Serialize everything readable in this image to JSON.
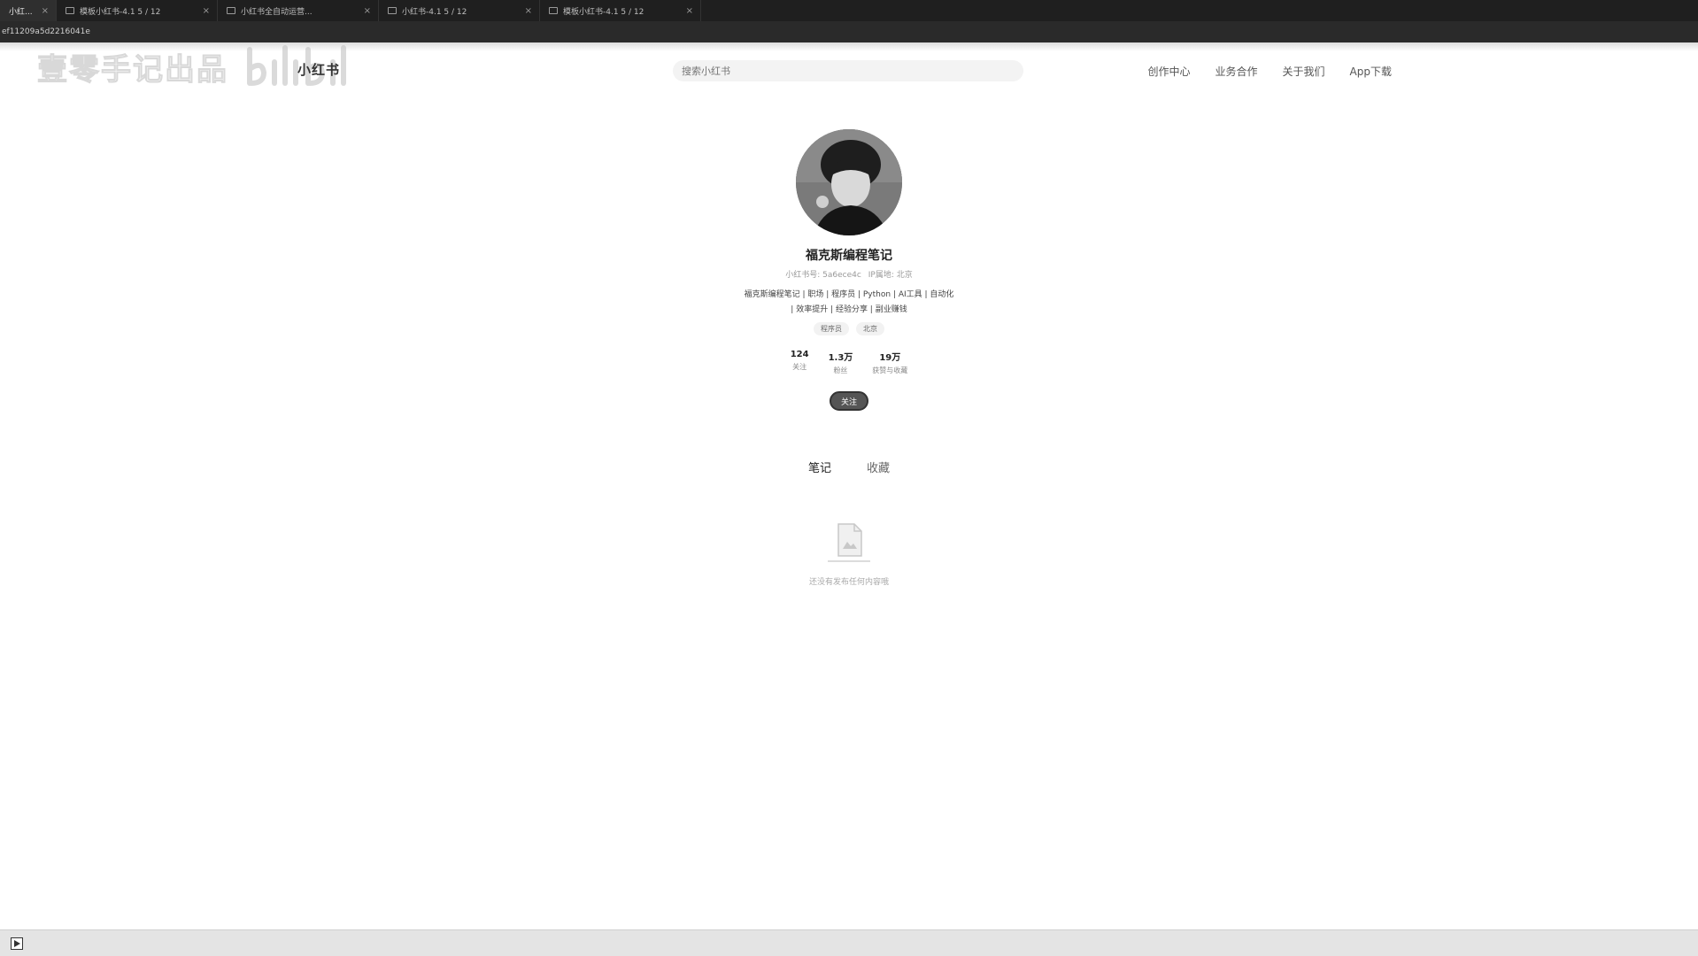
{
  "browser": {
    "tabs": [
      {
        "title": "小红...",
        "active": true
      },
      {
        "title": "模板小红书-4.1 5 / 12",
        "active": false
      },
      {
        "title": "小红书全自动运营...",
        "active": false
      },
      {
        "title": "小红书-4.1 5 / 12",
        "active": false
      },
      {
        "title": "模板小红书-4.1 5 / 12",
        "active": false
      }
    ],
    "address": "ef11209a5d2216041e"
  },
  "watermark": {
    "text": "壹零手记出品",
    "logo_text": "bilibili"
  },
  "header": {
    "brand": "小红书",
    "search_placeholder": "搜索小红书",
    "nav": [
      "创作中心",
      "业务合作",
      "关于我们",
      "App下载"
    ]
  },
  "profile": {
    "name": "福克斯编程笔记",
    "meta": [
      "小红书号: 5a6ece4c",
      "IP属地: 北京"
    ],
    "bio_lines": [
      "福克斯编程笔记 | 职场 | 程序员 | Python | AI工具 | 自动化",
      "| 效率提升 | 经验分享 | 副业赚钱"
    ],
    "tags": [
      "程序员",
      "北京"
    ],
    "stats": [
      {
        "num": "124",
        "label": "关注"
      },
      {
        "num": "1.3万",
        "label": "粉丝"
      },
      {
        "num": "19万",
        "label": "获赞与收藏"
      }
    ],
    "follow_label": "关注"
  },
  "content_tabs": [
    "笔记",
    "收藏"
  ],
  "empty_state": {
    "text": "还没有发布任何内容哦"
  }
}
